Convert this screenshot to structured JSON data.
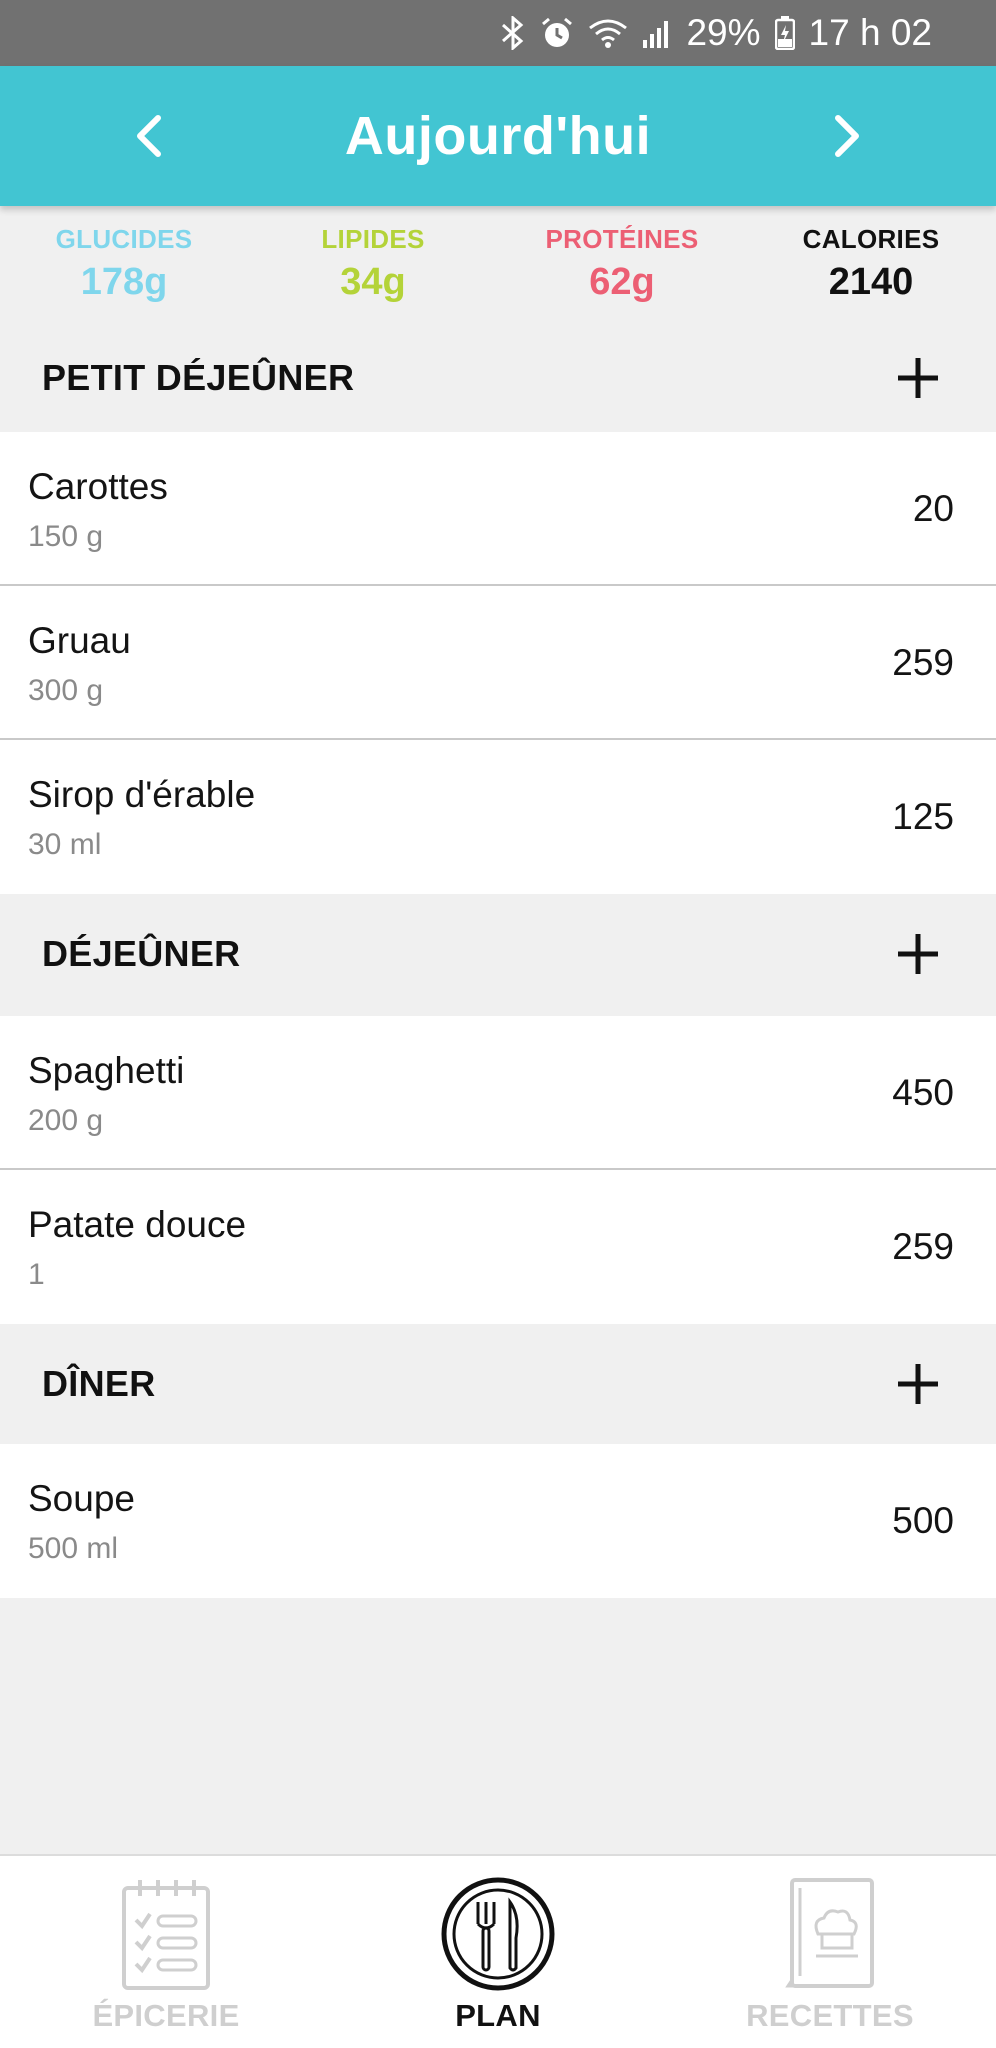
{
  "status_bar": {
    "battery": "29%",
    "time": "17 h 02",
    "icons": [
      "bluetooth-icon",
      "alarm-icon",
      "wifi-icon",
      "signal-icon",
      "battery-icon"
    ]
  },
  "header": {
    "title": "Aujourd'hui",
    "prev_icon": "chevron-left-icon",
    "next_icon": "chevron-right-icon"
  },
  "macros": [
    {
      "label": "GLUCIDES",
      "value": "178g",
      "color": "#7fd6ec"
    },
    {
      "label": "LIPIDES",
      "value": "34g",
      "color": "#b4d339"
    },
    {
      "label": "PROTÉINES",
      "value": "62g",
      "color": "#ec5f74"
    },
    {
      "label": "CALORIES",
      "value": "2140",
      "color": "#111111"
    }
  ],
  "meals": [
    {
      "title": "PETIT DÉJEÛNER",
      "items": [
        {
          "name": "Carottes",
          "qty": "150 g",
          "cal": "20"
        },
        {
          "name": "Gruau",
          "qty": "300 g",
          "cal": "259"
        },
        {
          "name": "Sirop d'érable",
          "qty": "30 ml",
          "cal": "125"
        }
      ]
    },
    {
      "title": "DÉJEÛNER",
      "items": [
        {
          "name": "Spaghetti",
          "qty": "200 g",
          "cal": "450"
        },
        {
          "name": "Patate douce",
          "qty": "1",
          "cal": "259"
        }
      ]
    },
    {
      "title": "DÎNER",
      "items": [
        {
          "name": "Soupe",
          "qty": "500 ml",
          "cal": "500"
        }
      ]
    }
  ],
  "bottom_nav": [
    {
      "label": "ÉPICERIE",
      "icon": "checklist-icon",
      "active": false
    },
    {
      "label": "PLAN",
      "icon": "plate-fork-knife-icon",
      "active": true
    },
    {
      "label": "RECETTES",
      "icon": "recipe-book-icon",
      "active": false
    }
  ],
  "colors": {
    "accent": "#42c5d2",
    "status_bar": "#717171",
    "inactive_nav": "#cfcfcf"
  }
}
